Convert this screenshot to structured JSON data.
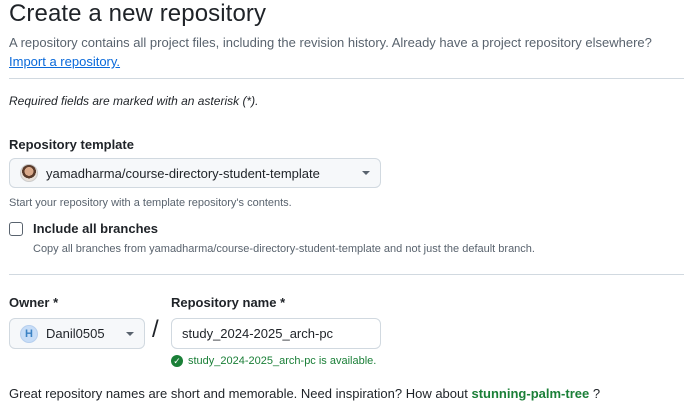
{
  "header": {
    "title": "Create a new repository",
    "description": "A repository contains all project files, including the revision history. Already have a project repository elsewhere?",
    "import_link": "Import a repository."
  },
  "required_note": "Required fields are marked with an asterisk (*).",
  "template": {
    "label": "Repository template",
    "selected": "yamadharma/course-directory-student-template",
    "hint": "Start your repository with a template repository's contents."
  },
  "include_branches": {
    "label": "Include all branches",
    "checked": false,
    "hint": "Copy all branches from yamadharma/course-directory-student-template and not just the default branch."
  },
  "owner": {
    "label": "Owner *",
    "value": "Danil0505",
    "avatar_letter": "H"
  },
  "separator": "/",
  "repo_name": {
    "label": "Repository name *",
    "value": "study_2024-2025_arch-pc",
    "availability": "study_2024-2025_arch-pc is available."
  },
  "suggestion": {
    "prefix": "Great repository names are short and memorable. Need inspiration? How about",
    "name": "stunning-palm-tree",
    "suffix": "?"
  },
  "colors": {
    "link": "#0969da",
    "success": "#1a7f37",
    "border": "#d1d9e0",
    "muted_text": "#59636e"
  }
}
